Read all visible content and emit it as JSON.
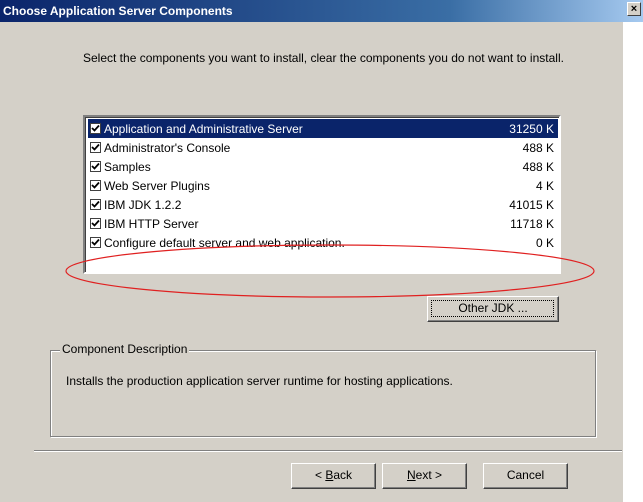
{
  "window": {
    "title": "Choose Application Server Components",
    "close_glyph": "×"
  },
  "instructions": "Select the components you want to install, clear the components you do not want to install.",
  "components": [
    {
      "name": "Application and Administrative Server",
      "size": "31250 K",
      "checked": true,
      "selected": true
    },
    {
      "name": "Administrator's Console",
      "size": "488 K",
      "checked": true,
      "selected": false
    },
    {
      "name": "Samples",
      "size": "488 K",
      "checked": true,
      "selected": false
    },
    {
      "name": "Web Server Plugins",
      "size": "4 K",
      "checked": true,
      "selected": false
    },
    {
      "name": "IBM JDK 1.2.2",
      "size": "41015 K",
      "checked": true,
      "selected": false
    },
    {
      "name": "IBM HTTP Server",
      "size": "11718 K",
      "checked": true,
      "selected": false
    },
    {
      "name": "Configure default server and web application.",
      "size": "0 K",
      "checked": true,
      "selected": false
    }
  ],
  "other_jdk_button": "Other JDK ...",
  "description": {
    "legend": "Component Description",
    "text": "Installs the production application server runtime for hosting applications."
  },
  "buttons": {
    "back_accel": "B",
    "back_rest": "ack",
    "back_prefix": "< ",
    "next_accel": "N",
    "next_rest": "ext >",
    "cancel": "Cancel"
  },
  "colors": {
    "selection": "#0a246a",
    "annotation": "#e02020",
    "face": "#d4d0c8"
  }
}
